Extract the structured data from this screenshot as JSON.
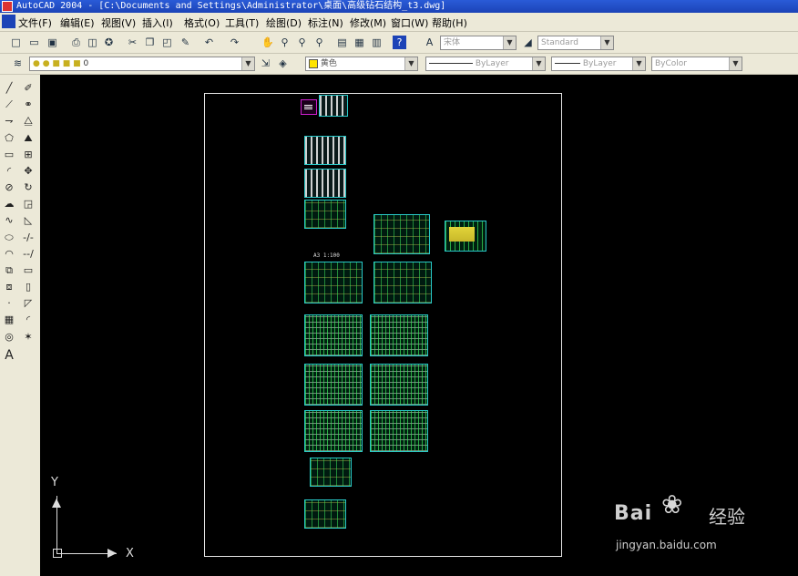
{
  "window": {
    "title": "AutoCAD 2004 - [C:\\Documents and Settings\\Administrator\\桌面\\高级钻石结构_t3.dwg]"
  },
  "menu": [
    "文件(F)",
    "编辑(E)",
    "视图(V)",
    "插入(I)",
    "格式(O)",
    "工具(T)",
    "绘图(D)",
    "标注(N)",
    "修改(M)",
    "窗口(W)",
    "帮助(H)"
  ],
  "styles": {
    "text_style": "宋体",
    "dim_style": "Standard"
  },
  "properties": {
    "layer": "0",
    "color": "黄色",
    "linetype": "ByLayer",
    "lineweight": "ByLayer",
    "plotstyle": "ByColor"
  },
  "drawing": {
    "annotation": "A3 1:100"
  },
  "ucs": {
    "x_label": "X",
    "y_label": "Y"
  },
  "watermark": {
    "brand": "Bai",
    "cn": "经验",
    "url": "jingyan.baidu.com"
  },
  "icons": {
    "left_toolbar": [
      "line-icon",
      "construction-line-icon",
      "polyline-icon",
      "polygon-icon",
      "rectangle-icon",
      "arc-icon",
      "circle-icon",
      "revision-cloud-icon",
      "spline-icon",
      "ellipse-icon",
      "ellipse-arc-icon",
      "insert-block-icon",
      "make-block-icon",
      "point-icon",
      "hatch-icon",
      "region-icon",
      "text-icon"
    ]
  }
}
